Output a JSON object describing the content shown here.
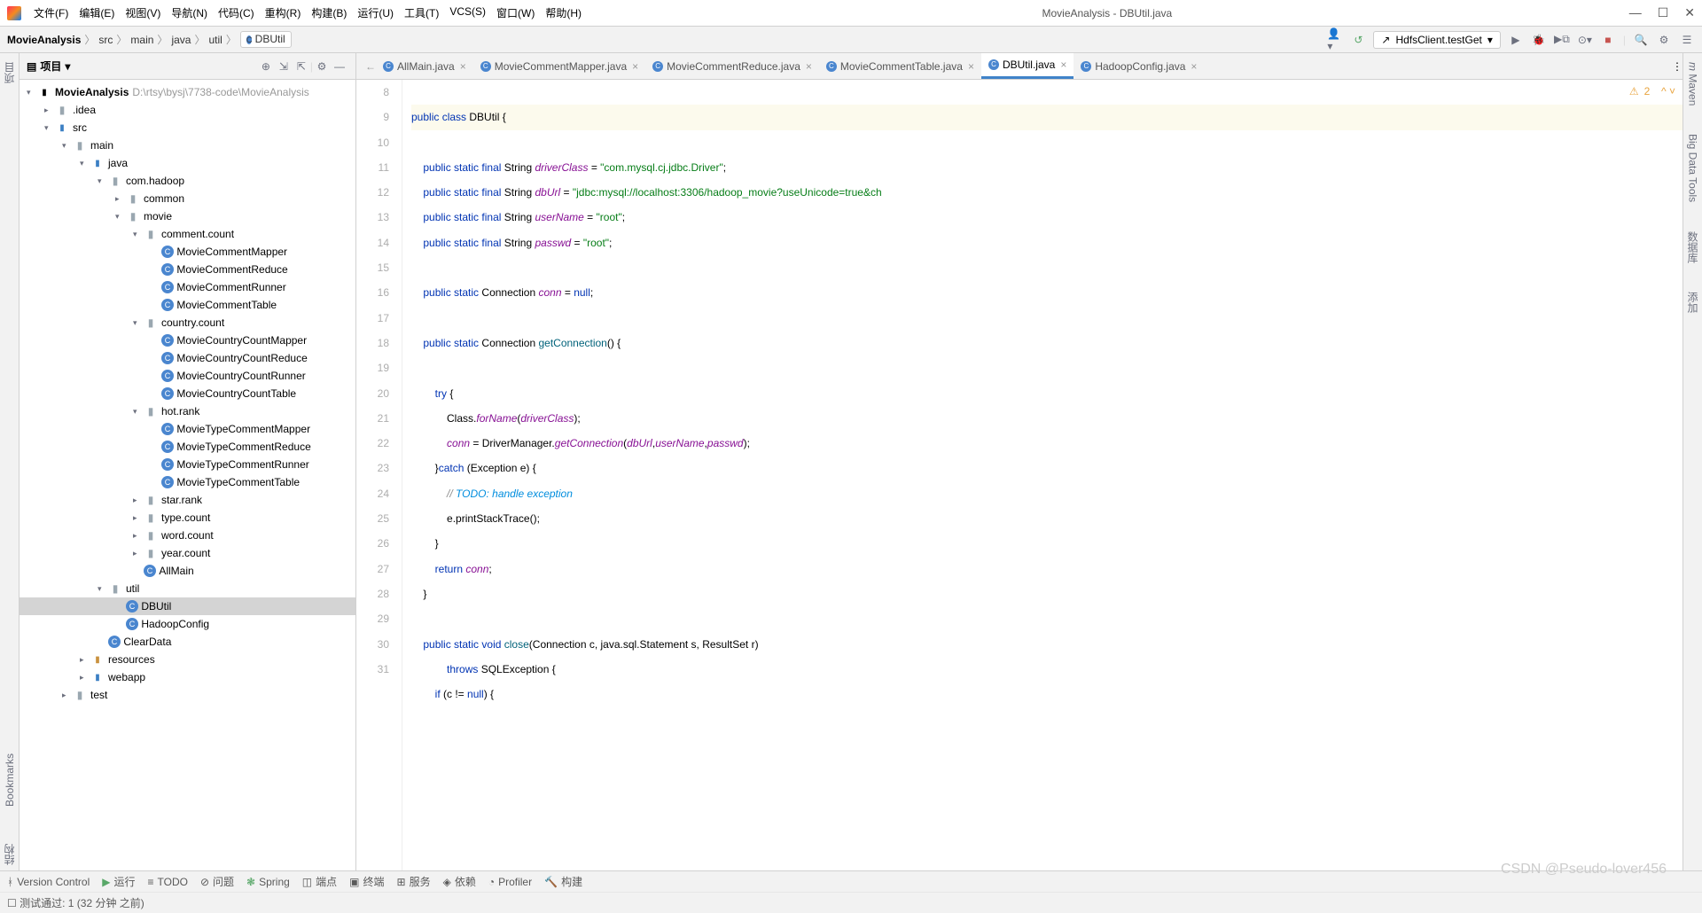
{
  "window": {
    "title_app": "MovieAnalysis",
    "title_file": "DBUtil.java"
  },
  "menu": [
    "文件(F)",
    "编辑(E)",
    "视图(V)",
    "导航(N)",
    "代码(C)",
    "重构(R)",
    "构建(B)",
    "运行(U)",
    "工具(T)",
    "VCS(S)",
    "窗口(W)",
    "帮助(H)"
  ],
  "breadcrumb": [
    "MovieAnalysis",
    "src",
    "main",
    "java",
    "util",
    "DBUtil"
  ],
  "run_config": "HdfsClient.testGet",
  "project_panel": {
    "title": "项目"
  },
  "tree": {
    "root": "MovieAnalysis",
    "root_path": "D:\\rtsy\\bysj\\7738-code\\MovieAnalysis",
    "idea": ".idea",
    "src": "src",
    "main": "main",
    "java": "java",
    "com_hadoop": "com.hadoop",
    "common": "common",
    "movie": "movie",
    "comment_count": "comment.count",
    "mcm": "MovieCommentMapper",
    "mcr": "MovieCommentReduce",
    "mcrun": "MovieCommentRunner",
    "mct": "MovieCommentTable",
    "country_count": "country.count",
    "mccm": "MovieCountryCountMapper",
    "mccr": "MovieCountryCountReduce",
    "mccrun": "MovieCountryCountRunner",
    "mcct": "MovieCountryCountTable",
    "hot_rank": "hot.rank",
    "mtcm": "MovieTypeCommentMapper",
    "mtcr": "MovieTypeCommentReduce",
    "mtcrun": "MovieTypeCommentRunner",
    "mtct": "MovieTypeCommentTable",
    "star_rank": "star.rank",
    "type_count": "type.count",
    "word_count": "word.count",
    "year_count": "year.count",
    "allmain": "AllMain",
    "util": "util",
    "dbutil": "DBUtil",
    "hadoopconfig": "HadoopConfig",
    "cleardata": "ClearData",
    "resources": "resources",
    "webapp": "webapp",
    "test": "test"
  },
  "tabs": [
    {
      "label": "AllMain.java",
      "active": false
    },
    {
      "label": "MovieCommentMapper.java",
      "active": false
    },
    {
      "label": "MovieCommentReduce.java",
      "active": false
    },
    {
      "label": "MovieCommentTable.java",
      "active": false
    },
    {
      "label": "DBUtil.java",
      "active": true
    },
    {
      "label": "HadoopConfig.java",
      "active": false
    }
  ],
  "indicator": {
    "warn_count": "2"
  },
  "line_numbers": [
    "8",
    "9",
    "10",
    "11",
    "12",
    "13",
    "14",
    "15",
    "16",
    "17",
    "18",
    "19",
    "20",
    "21",
    "22",
    "23",
    "24",
    "25",
    "26",
    "27",
    "28",
    "29",
    "30",
    "31"
  ],
  "code": {
    "l8a": "public",
    "l8b": "class",
    "l8c": "DBUtil",
    "l8d": " {",
    "l10a": "public",
    "l10b": "static",
    "l10c": "final",
    "l10d": "String",
    "l10e": "driverClass",
    "l10f": " = ",
    "l10g": "\"com.mysql.cj.jdbc.Driver\"",
    "l10h": ";",
    "l11a": "public",
    "l11b": "static",
    "l11c": "final",
    "l11d": "String",
    "l11e": "dbUrl",
    "l11f": " = ",
    "l11g": "\"jdbc:mysql://localhost:3306/hadoop_movie?useUnicode=true&ch",
    "l12a": "public",
    "l12b": "static",
    "l12c": "final",
    "l12d": "String",
    "l12e": "userName",
    "l12f": " = ",
    "l12g": "\"root\"",
    "l12h": ";",
    "l13a": "public",
    "l13b": "static",
    "l13c": "final",
    "l13d": "String",
    "l13e": "passwd",
    "l13f": " = ",
    "l13g": "\"root\"",
    "l13h": ";",
    "l15a": "public",
    "l15b": "static",
    "l15c": "Connection",
    "l15d": "conn",
    "l15e": " = ",
    "l15f": "null",
    "l15g": ";",
    "l17a": "public",
    "l17b": "static",
    "l17c": "Connection",
    "l17d": "getConnection",
    "l17e": "() {",
    "l19a": "try",
    "l19b": " {",
    "l20a": "Class.",
    "l20b": "forName",
    "l20c": "(",
    "l20d": "driverClass",
    "l20e": ");",
    "l21a": "conn",
    "l21b": " = DriverManager.",
    "l21c": "getConnection",
    "l21d": "(",
    "l21e": "dbUrl",
    "l21f": ",",
    "l21g": "userName",
    "l21h": ",",
    "l21i": "passwd",
    "l21j": ");",
    "l22a": "}",
    "l22b": "catch",
    "l22c": " (Exception e) {",
    "l23a": "// ",
    "l23b": "TODO: handle exception",
    "l24a": "e.printStackTrace();",
    "l25a": "}",
    "l26a": "return",
    "l26b": " ",
    "l26c": "conn",
    "l26d": ";",
    "l27a": "}",
    "l29a": "public",
    "l29b": "static",
    "l29c": "void",
    "l29d": "close",
    "l29e": "(Connection c, java.sql.Statement s, ResultSet r)",
    "l30a": "throws",
    "l30b": " SQLException {",
    "l31a": "if",
    "l31b": " (c != ",
    "l31c": "null",
    "l31d": ") {"
  },
  "sidebar_left": {
    "project": "项目",
    "bookmarks": "Bookmarks",
    "structure": "结构"
  },
  "sidebar_right": {
    "maven": "Maven",
    "bigdata": "Big Data Tools",
    "db": "数据库",
    "add": "添加"
  },
  "statusbar": {
    "version_control": "Version Control",
    "run": "运行",
    "todo": "TODO",
    "problems": "问题",
    "spring": "Spring",
    "breakpoints": "端点",
    "terminal": "终端",
    "services": "服务",
    "deps": "依赖",
    "profiler": "Profiler",
    "build": "构建"
  },
  "statusbar2": "测试通过: 1 (32 分钟 之前)",
  "watermark": "CSDN @Pseudo-lover456"
}
